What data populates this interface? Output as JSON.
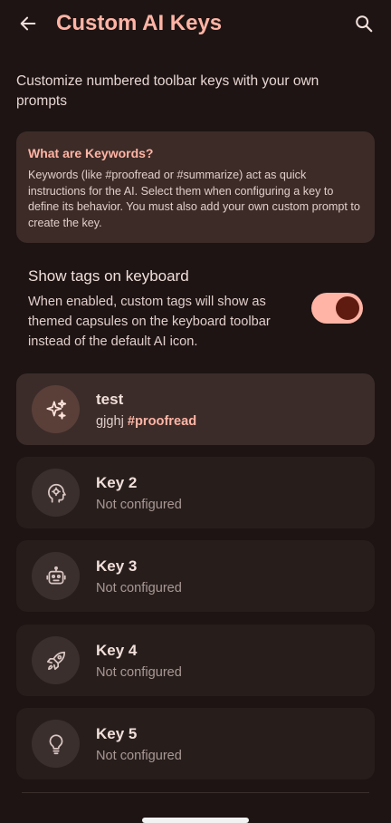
{
  "header": {
    "title": "Custom AI Keys",
    "back_icon": "arrow-left-icon",
    "search_icon": "search-icon"
  },
  "subtitle": "Customize numbered toolbar keys with your own prompts",
  "info_card": {
    "title": "What are Keywords?",
    "body": "Keywords (like #proofread or #summarize) act as quick instructions for the AI. Select them when configuring a key to define its behavior. You must also add your own custom prompt to create the key."
  },
  "tags_toggle": {
    "title": "Show tags on keyboard",
    "description": "When enabled, custom tags will show as themed capsules on the keyboard toolbar instead of the default AI icon.",
    "enabled": true
  },
  "keys": [
    {
      "name": "test",
      "description": "gjghj",
      "tag": "#proofread",
      "icon": "sparkles-icon",
      "configured": true
    },
    {
      "name": "Key 2",
      "description": "Not configured",
      "tag": "",
      "icon": "head-gear-icon",
      "configured": false
    },
    {
      "name": "Key 3",
      "description": "Not configured",
      "tag": "",
      "icon": "robot-icon",
      "configured": false
    },
    {
      "name": "Key 4",
      "description": "Not configured",
      "tag": "",
      "icon": "rocket-icon",
      "configured": false
    },
    {
      "name": "Key 5",
      "description": "Not configured",
      "tag": "",
      "icon": "lightbulb-icon",
      "configured": false
    }
  ],
  "colors": {
    "background": "#1d1413",
    "accent": "#ffb4a5",
    "card": "#3c2b27",
    "switch_thumb": "#5f1b0f"
  }
}
